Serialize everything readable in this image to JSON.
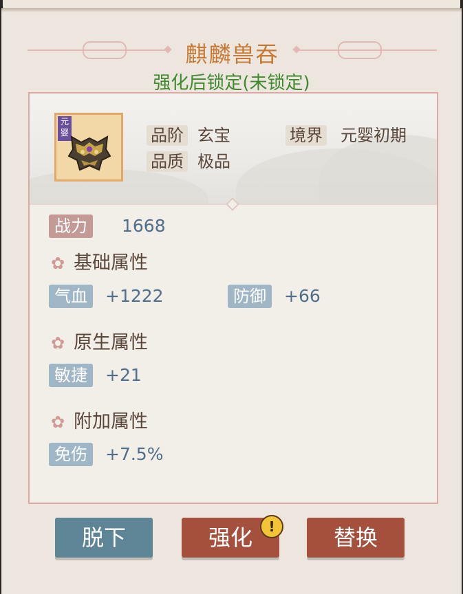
{
  "item": {
    "name": "麒麟兽吞",
    "lock_status": "强化后锁定(未锁定)",
    "realm_badge": "元婴",
    "icon": "qilin-mask-icon"
  },
  "info": {
    "grade_label": "品阶",
    "grade_value": "玄宝",
    "quality_label": "品质",
    "quality_value": "极品",
    "realm_label": "境界",
    "realm_value": "元婴初期"
  },
  "power": {
    "label": "战力",
    "value": "1668"
  },
  "sections": {
    "base": {
      "title": "基础属性",
      "stats": [
        {
          "label": "气血",
          "value": "+1222"
        },
        {
          "label": "防御",
          "value": "+66"
        }
      ]
    },
    "native": {
      "title": "原生属性",
      "stats": [
        {
          "label": "敏捷",
          "value": "+21"
        }
      ]
    },
    "extra": {
      "title": "附加属性",
      "stats": [
        {
          "label": "免伤",
          "value": "+7.5%"
        }
      ]
    }
  },
  "buttons": {
    "unequip": "脱下",
    "enhance": "强化",
    "enhance_alert": "!",
    "replace": "替换"
  },
  "colors": {
    "title": "#c87a34",
    "lock_status": "#3f8a2e",
    "stat_value": "#4e6e8c",
    "blue_button": "#5d8595",
    "red_button": "#a4503d"
  }
}
